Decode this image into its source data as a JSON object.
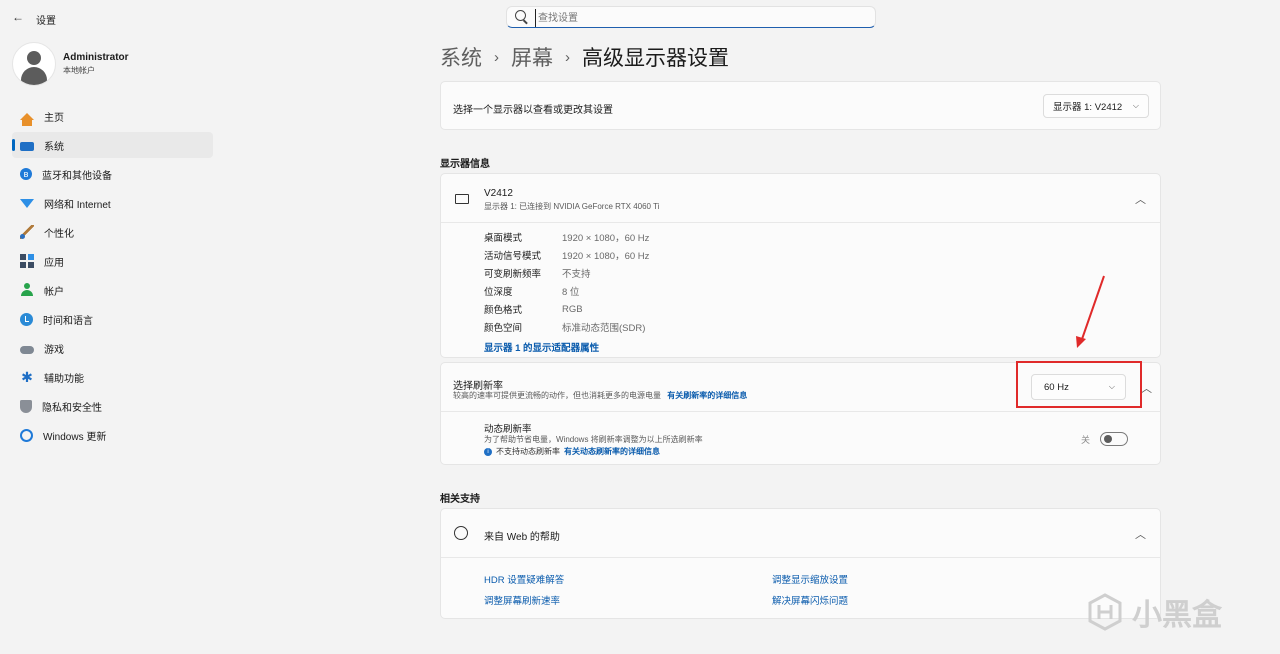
{
  "window": {
    "back_glyph": "←",
    "title": "设置"
  },
  "search": {
    "placeholder": "查找设置"
  },
  "user": {
    "name": "Administrator",
    "account_type": "本地帐户"
  },
  "sidebar": {
    "items": [
      {
        "label": "主页",
        "icon": "home-icon"
      },
      {
        "label": "系统",
        "icon": "system-icon",
        "active": true
      },
      {
        "label": "蓝牙和其他设备",
        "icon": "bluetooth-icon"
      },
      {
        "label": "网络和 Internet",
        "icon": "wifi-icon"
      },
      {
        "label": "个性化",
        "icon": "brush-icon"
      },
      {
        "label": "应用",
        "icon": "apps-icon"
      },
      {
        "label": "帐户",
        "icon": "account-icon"
      },
      {
        "label": "时间和语言",
        "icon": "time-language-icon"
      },
      {
        "label": "游戏",
        "icon": "gamepad-icon"
      },
      {
        "label": "辅助功能",
        "icon": "accessibility-icon"
      },
      {
        "label": "隐私和安全性",
        "icon": "shield-icon"
      },
      {
        "label": "Windows 更新",
        "icon": "update-icon"
      }
    ]
  },
  "breadcrumb": {
    "items": [
      "系统",
      "屏幕"
    ],
    "separator": "›",
    "current": "高级显示器设置"
  },
  "display_select": {
    "label": "选择一个显示器以查看或更改其设置",
    "value": "显示器 1: V2412"
  },
  "display_info": {
    "section_title": "显示器信息",
    "monitor_name": "V2412",
    "monitor_sub": "显示器 1: 已连接到 NVIDIA GeForce RTX 4060 Ti",
    "rows": [
      {
        "k": "桌面模式",
        "v": "1920 × 1080，60 Hz"
      },
      {
        "k": "活动信号模式",
        "v": "1920 × 1080，60 Hz"
      },
      {
        "k": "可变刷新频率",
        "v": "不支持"
      },
      {
        "k": "位深度",
        "v": "8 位"
      },
      {
        "k": "颜色格式",
        "v": "RGB"
      },
      {
        "k": "颜色空间",
        "v": "标准动态范围(SDR)"
      }
    ],
    "adapter_link": "显示器 1 的显示适配器属性"
  },
  "refresh": {
    "label": "选择刷新率",
    "sub": "较高的速率可提供更流畅的动作，但也消耗更多的电源电量",
    "sub_link": "有关刷新率的详细信息",
    "value": "60 Hz",
    "dynamic_label": "动态刷新率",
    "dynamic_sub": "为了帮助节省电量，Windows 将刷新率调整为以上所选刷新率",
    "dynamic_unsupported": "不支持动态刷新率",
    "dynamic_link": "有关动态刷新率的详细信息",
    "toggle_state": "关"
  },
  "support": {
    "section_title": "相关支持",
    "help_label": "来自 Web 的帮助",
    "links": [
      "HDR 设置疑难解答",
      "调整显示缩放设置",
      "调整屏幕刷新速率",
      "解决屏幕闪烁问题"
    ]
  },
  "watermark": {
    "text": "小黑盒"
  },
  "colors": {
    "accent": "#0067c0",
    "link": "#0b5cad",
    "annotation_red": "#e02a2a"
  }
}
